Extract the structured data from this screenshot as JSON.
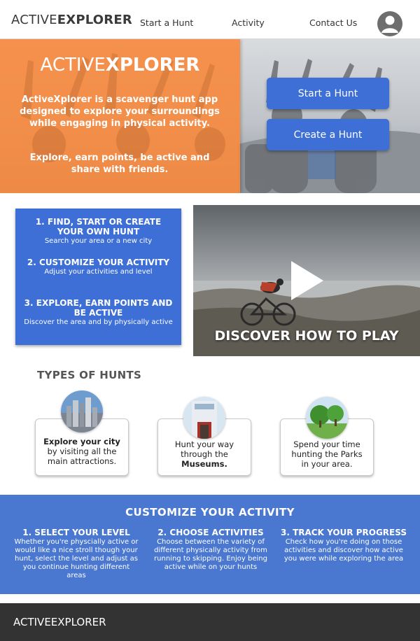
{
  "nav": {
    "logo_light": "ACTIVE",
    "logo_bold": "EXPLORER",
    "links": [
      "Start a Hunt",
      "Activity",
      "Contact Us"
    ],
    "avatar_icon": "user-avatar-icon"
  },
  "hero": {
    "title_light": "ACTIVE",
    "title_bold": "XPLORER",
    "description": "ActiveXplorer is a scavenger hunt app designed to explore your surroundings while engaging in physical activity.",
    "tagline": "Explore, earn points, be active and share with friends.",
    "buttons": [
      "Start a Hunt",
      "Create a Hunt"
    ],
    "overlay_color": "#f7883c"
  },
  "steps": [
    {
      "title": "1. FIND, START OR CREATE YOUR OWN HUNT",
      "sub": "Search your area or a new city"
    },
    {
      "title": "2. CUSTOMIZE YOUR ACTIVITY",
      "sub": "Adjust your activities and level"
    },
    {
      "title": "3. EXPLORE, EARN POINTS AND BE ACTIVE",
      "sub": "Discover the area and by physically active"
    }
  ],
  "video": {
    "label": "DISCOVER HOW TO PLAY",
    "icon": "play-icon"
  },
  "types": {
    "title": "TYPES OF HUNTS",
    "cards": [
      {
        "line1": "Explore your city",
        "line2": "by visiting all the",
        "line3": "main attractions.",
        "icon": "city-skyline-photo"
      },
      {
        "line1": "Hunt your way",
        "line2": "through the",
        "line3": "Museums.",
        "icon": "museum-photo"
      },
      {
        "line1": "Spend your time",
        "line2": "hunting the Parks",
        "line3": "in your area.",
        "icon": "park-photo"
      }
    ]
  },
  "customize": {
    "title": "CUSTOMIZE YOUR ACTIVITY",
    "columns": [
      {
        "title": "1. SELECT YOUR LEVEL",
        "text": "Whether you're physcially active or would like a nice stroll though your hunt, select the level and adjust as you continue hunting different areas"
      },
      {
        "title": "2. CHOOSE ACTIVITIES",
        "text": "Choose between the variety of different physically activity from running to skipping. Enjoy being active while on your hunts"
      },
      {
        "title": "3. TRACK YOUR PROGRESS",
        "text": "Check how you're doing on those activities and discover how active you were while exploring the area"
      }
    ],
    "color": "#4a77cf"
  },
  "footer": {
    "logo_light": "ACTIVE",
    "logo_bold": "EXPLORER"
  },
  "colors": {
    "primary_button": "#3d6fd6",
    "footer": "#333333"
  }
}
